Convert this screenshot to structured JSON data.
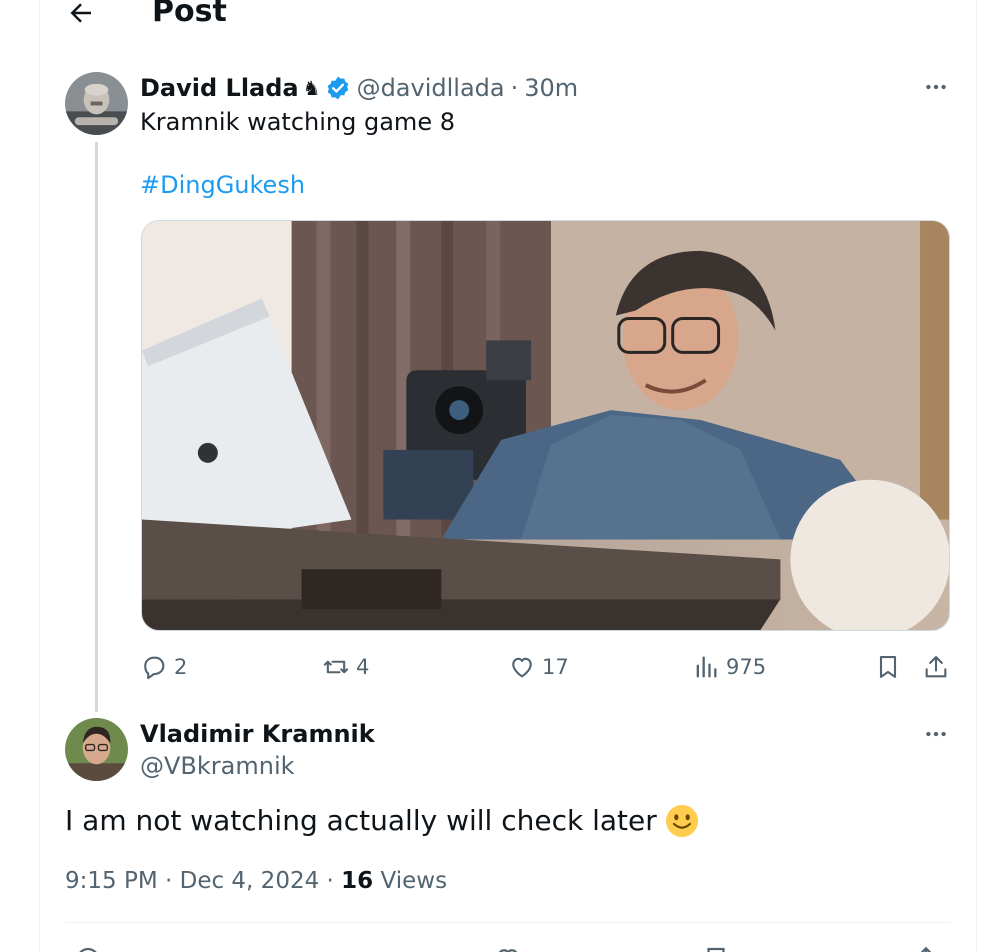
{
  "header": {
    "title": "Post"
  },
  "parent_post": {
    "author_name": "David Llada",
    "author_badge": "♞",
    "handle": "@davidllada",
    "separator": "·",
    "time": "30m",
    "text": "Kramnik watching game 8",
    "hashtag": "#DingGukesh",
    "stats": {
      "replies": "2",
      "reposts": "4",
      "likes": "17",
      "views": "975"
    }
  },
  "reply_post": {
    "author_name": "Vladimir Kramnik",
    "handle": "@VBkramnik",
    "text": "I am not watching actually will check later",
    "time": "9:15 PM · Dec 4, 2024 · ",
    "views_count": "16",
    "views_label": " Views"
  },
  "colors": {
    "accent": "#1d9bf0",
    "secondary_text": "#536471",
    "primary_text": "#0f1419",
    "border": "#eff3f4"
  },
  "icons": [
    "back-arrow-icon",
    "verified-badge-icon",
    "more-icon",
    "reply-icon",
    "repost-icon",
    "like-icon",
    "views-icon",
    "bookmark-icon",
    "share-icon",
    "smile-emoji-icon"
  ]
}
